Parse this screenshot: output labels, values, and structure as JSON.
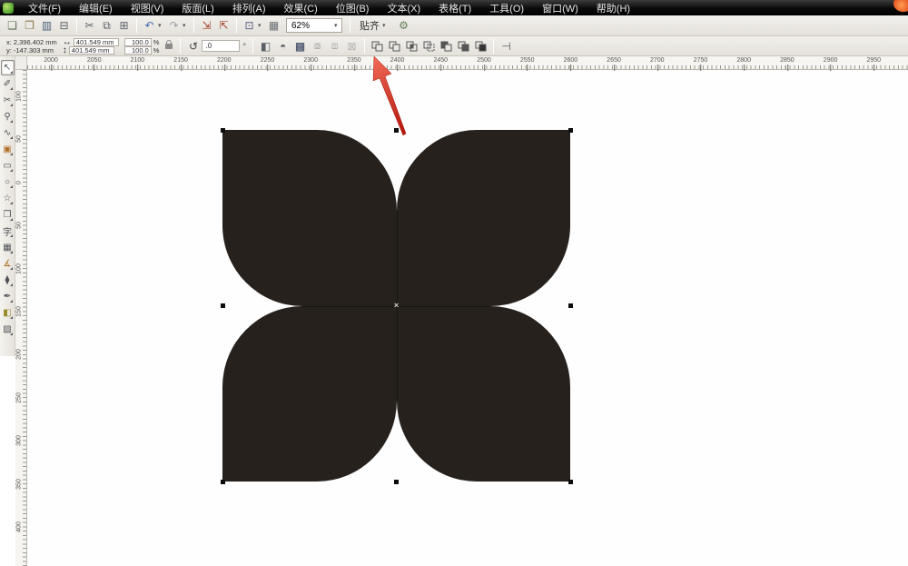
{
  "app": {
    "menus": [
      {
        "key": "file",
        "label": "文件(F)"
      },
      {
        "key": "edit",
        "label": "编辑(E)"
      },
      {
        "key": "view",
        "label": "视图(V)"
      },
      {
        "key": "layout",
        "label": "版面(L)"
      },
      {
        "key": "arrange",
        "label": "排列(A)"
      },
      {
        "key": "effects",
        "label": "效果(C)"
      },
      {
        "key": "bitmaps",
        "label": "位图(B)"
      },
      {
        "key": "text",
        "label": "文本(X)"
      },
      {
        "key": "table",
        "label": "表格(T)"
      },
      {
        "key": "tools",
        "label": "工具(O)"
      },
      {
        "key": "window",
        "label": "窗口(W)"
      },
      {
        "key": "help",
        "label": "帮助(H)"
      }
    ]
  },
  "standard_toolbar": {
    "zoom_value": "62%",
    "snap_label": "贴齐",
    "items": [
      {
        "type": "button",
        "name": "new-document",
        "glyph": "❏",
        "color": "#5a6e4e"
      },
      {
        "type": "button",
        "name": "open",
        "glyph": "❒",
        "color": "#8a7a4a"
      },
      {
        "type": "button",
        "name": "save",
        "glyph": "▥",
        "color": "#4a5d7a"
      },
      {
        "type": "button",
        "name": "print",
        "glyph": "⊟",
        "color": "#5a5f66"
      },
      {
        "type": "sep"
      },
      {
        "type": "button",
        "name": "cut",
        "glyph": "✂",
        "color": "#5a5f66"
      },
      {
        "type": "button",
        "name": "copy",
        "glyph": "⧉",
        "color": "#5a5f66"
      },
      {
        "type": "button",
        "name": "paste",
        "glyph": "⊞",
        "color": "#5a5f66"
      },
      {
        "type": "sep"
      },
      {
        "type": "button",
        "name": "undo",
        "glyph": "↶",
        "color": "#3f6fae",
        "caret": true
      },
      {
        "type": "button",
        "name": "redo",
        "glyph": "↷",
        "color": "#9aa0a8",
        "caret": true
      },
      {
        "type": "sep"
      },
      {
        "type": "button",
        "name": "import",
        "glyph": "⇲",
        "color": "#a04028"
      },
      {
        "type": "button",
        "name": "export",
        "glyph": "⇱",
        "color": "#a04028"
      },
      {
        "type": "sep"
      },
      {
        "type": "button",
        "name": "application-launcher",
        "glyph": "⊡",
        "color": "#555b80",
        "caret": true
      },
      {
        "type": "button",
        "name": "welcome-screen",
        "glyph": "▦",
        "color": "#6a6f74"
      },
      {
        "type": "zoom"
      },
      {
        "type": "sep"
      },
      {
        "type": "snap"
      },
      {
        "type": "button",
        "name": "options",
        "glyph": "⚙",
        "color": "#5f7d55"
      }
    ]
  },
  "property_bar": {
    "x_label": "x:",
    "x_value": "2,396.402 mm",
    "y_label": "y:",
    "y_value": "-147.303 mm",
    "width_icon": "↔",
    "height_icon": "↕",
    "width_value": "401.549 mm",
    "height_value": "401.549 mm",
    "scale_h": "100.0",
    "scale_v": "100.0",
    "percent": "%",
    "rotation_icon": "↺",
    "rotation_value": ".0",
    "degree": "°",
    "misc_buttons": [
      {
        "name": "mirror-horizontal",
        "glyph": "◧",
        "color": "#5a5f66"
      },
      {
        "name": "mirror-vertical",
        "glyph": "◓",
        "color": "#5a5f66"
      },
      {
        "name": "combine",
        "glyph": "▩",
        "color": "#2e3a56",
        "dark": true
      },
      {
        "name": "group",
        "glyph": "⧇",
        "disabled": true
      },
      {
        "name": "ungroup",
        "glyph": "⧈",
        "disabled": true
      },
      {
        "name": "ungroup-all",
        "glyph": "⊠",
        "disabled": true
      }
    ],
    "shaping_buttons": [
      {
        "name": "weld",
        "variant": "weld"
      },
      {
        "name": "trim",
        "variant": "trim"
      },
      {
        "name": "intersect",
        "variant": "intersect"
      },
      {
        "name": "simplify",
        "variant": "simplify"
      },
      {
        "name": "front-minus-back",
        "variant": "fmb"
      },
      {
        "name": "back-minus-front",
        "variant": "bmf"
      },
      {
        "name": "create-boundary",
        "variant": "boundary"
      }
    ],
    "tail_button": {
      "name": "align-distribute",
      "glyph": "⊣"
    }
  },
  "toolbox": {
    "tools": [
      {
        "name": "pick-tool",
        "glyph": "↖",
        "selected": true
      },
      {
        "name": "shape-tool",
        "glyph": "✐"
      },
      {
        "name": "crop-tool",
        "glyph": "✂"
      },
      {
        "name": "zoom-tool",
        "glyph": "⚲"
      },
      {
        "name": "freehand-tool",
        "glyph": "∿"
      },
      {
        "name": "smart-fill-tool",
        "glyph": "▣",
        "color": "#b3702a"
      },
      {
        "name": "rectangle-tool",
        "glyph": "▭"
      },
      {
        "name": "ellipse-tool",
        "glyph": "○"
      },
      {
        "name": "polygon-tool",
        "glyph": "☆"
      },
      {
        "name": "basic-shapes-tool",
        "glyph": "❒"
      },
      {
        "name": "text-tool",
        "glyph": "字"
      },
      {
        "name": "table-tool",
        "glyph": "▦"
      },
      {
        "name": "dimension-tool",
        "glyph": "∡",
        "color": "#b3702a"
      },
      {
        "name": "eyedropper-tool",
        "glyph": "⧫"
      },
      {
        "name": "outline-pen-tool",
        "glyph": "✒"
      },
      {
        "name": "fill-tool",
        "glyph": "◧",
        "color": "#9a8a2a"
      },
      {
        "name": "interactive-fill-tool",
        "glyph": "▨"
      }
    ]
  },
  "rulers": {
    "horizontal_labels": [
      "2000",
      "2050",
      "2100",
      "2150",
      "2200",
      "2250",
      "2300",
      "2350",
      "2400",
      "2450",
      "2500",
      "2550",
      "2600",
      "2650",
      "2700",
      "2750",
      "2800",
      "2850",
      "2900",
      "2950"
    ],
    "vertical_labels": [
      "100",
      "50",
      "0",
      "50",
      "100",
      "150",
      "200",
      "250",
      "300",
      "350",
      "400"
    ]
  },
  "canvas": {
    "shape_fill": "#26211d",
    "center_mark": "×"
  },
  "annotation": {
    "arrow_color_light": "#f26a57",
    "arrow_color_dark": "#b5160b"
  }
}
